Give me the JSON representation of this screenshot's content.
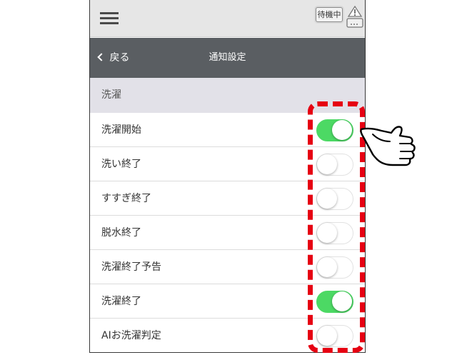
{
  "header": {
    "status_badge": "待機中"
  },
  "navbar": {
    "back_label": "戻る",
    "title": "通知設定"
  },
  "section": {
    "title": "洗濯"
  },
  "settings": [
    {
      "label": "洗濯開始",
      "on": true
    },
    {
      "label": "洗い終了",
      "on": false
    },
    {
      "label": "すすぎ終了",
      "on": false
    },
    {
      "label": "脱水終了",
      "on": false
    },
    {
      "label": "洗濯終了予告",
      "on": false
    },
    {
      "label": "洗濯終了",
      "on": true
    },
    {
      "label": "AIお洗濯判定",
      "on": false
    }
  ],
  "icons": {
    "menu": "hamburger-menu-icon",
    "warning": "warning-device-icon",
    "back": "chevron-left-icon",
    "pointer": "pointing-hand-icon"
  },
  "colors": {
    "toggle_on": "#4cd964",
    "highlight": "#e60012",
    "navbar": "#5a5e62",
    "section_bg": "#e2e1e8"
  }
}
